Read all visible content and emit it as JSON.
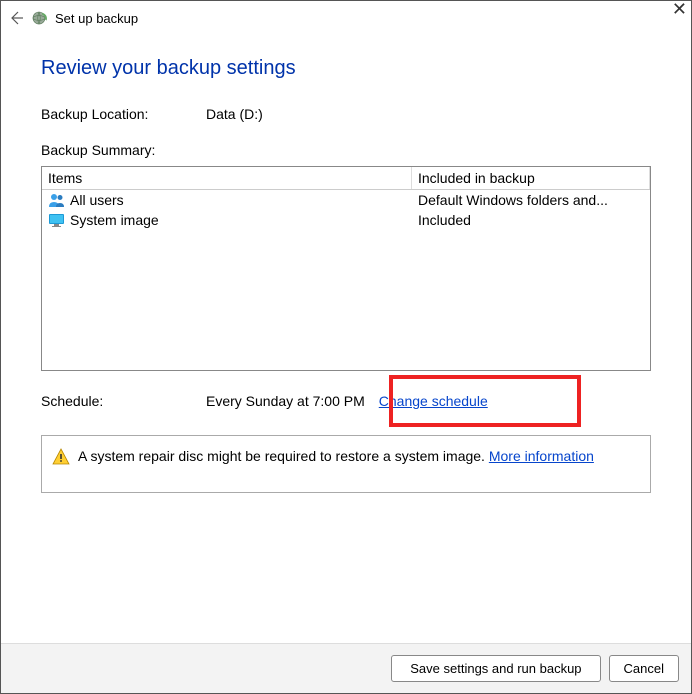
{
  "window": {
    "title": "Set up backup"
  },
  "heading": "Review your backup settings",
  "location": {
    "label": "Backup Location:",
    "value": "Data (D:)"
  },
  "summary_label": "Backup Summary:",
  "table": {
    "headers": {
      "col1": "Items",
      "col2": "Included in backup"
    },
    "rows": [
      {
        "icon": "users-icon",
        "item": "All users",
        "included": "Default Windows folders and..."
      },
      {
        "icon": "monitor-icon",
        "item": "System image",
        "included": "Included"
      }
    ]
  },
  "schedule": {
    "label": "Schedule:",
    "value": "Every Sunday at 7:00 PM",
    "change_link": "Change schedule"
  },
  "notice": {
    "text": "A system repair disc might be required to restore a system image. ",
    "link": "More information"
  },
  "buttons": {
    "save": "Save settings and run backup",
    "cancel": "Cancel"
  }
}
